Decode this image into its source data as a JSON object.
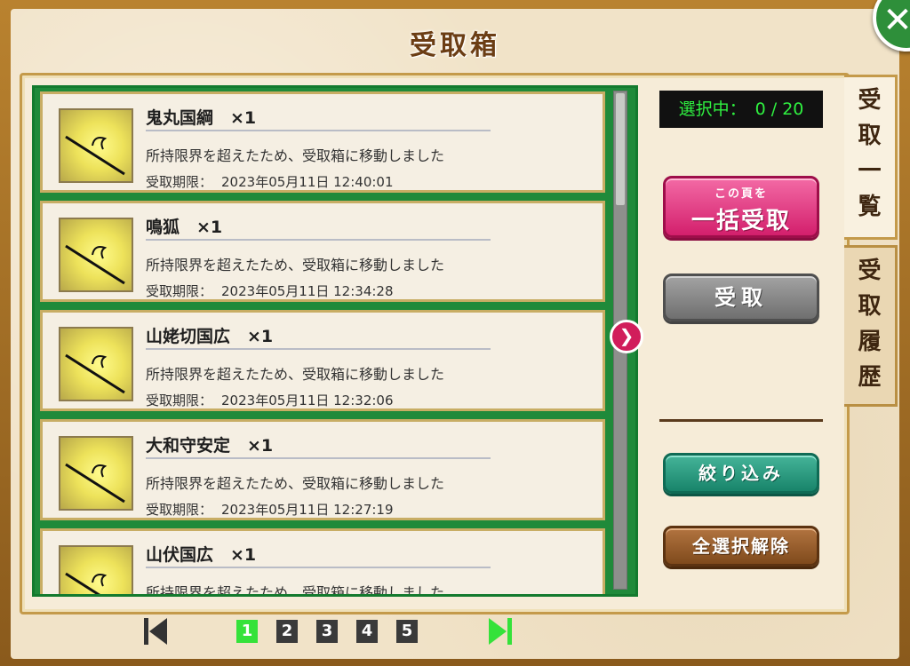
{
  "window": {
    "title": "受取箱",
    "close_label": "✕"
  },
  "selection": {
    "label": "選択中：",
    "value": "0 / 20"
  },
  "buttons": {
    "bulk_receive_sub": "この頁を",
    "bulk_receive_main": "一括受取",
    "receive": "受取",
    "filter": "絞り込み",
    "deselect_all": "全選択解除"
  },
  "tabs": [
    {
      "label": "受取一覧",
      "chars": [
        "受",
        "取",
        "一",
        "覧"
      ],
      "active": true
    },
    {
      "label": "受取履歴",
      "chars": [
        "受",
        "取",
        "履",
        "歴"
      ],
      "active": false
    }
  ],
  "list": {
    "items": [
      {
        "name": "鬼丸国綱　×1",
        "description": "所持限界を超えたため、受取箱に移動しました",
        "deadline_label": "受取期限：",
        "deadline": "2023年05月11日 12:40:01",
        "icon": "sword-icon"
      },
      {
        "name": "鳴狐　×1",
        "description": "所持限界を超えたため、受取箱に移動しました",
        "deadline_label": "受取期限：",
        "deadline": "2023年05月11日 12:34:28",
        "icon": "sword-icon"
      },
      {
        "name": "山姥切国広　×1",
        "description": "所持限界を超えたため、受取箱に移動しました",
        "deadline_label": "受取期限：",
        "deadline": "2023年05月11日 12:32:06",
        "icon": "sword-icon"
      },
      {
        "name": "大和守安定　×1",
        "description": "所持限界を超えたため、受取箱に移動しました",
        "deadline_label": "受取期限：",
        "deadline": "2023年05月11日 12:27:19",
        "icon": "sword-icon"
      },
      {
        "name": "山伏国広　×1",
        "description": "所持限界を超えたため、受取箱に移動しました",
        "deadline_label": "",
        "deadline": "",
        "icon": "sword-icon"
      }
    ]
  },
  "pager": {
    "pages": [
      "1",
      "2",
      "3",
      "4",
      "5"
    ],
    "current": "1",
    "first_icon": "skip-first-icon",
    "last_icon": "skip-last-icon"
  },
  "colors": {
    "list_border": "#1f8a3a",
    "bulk_button": "#d31f6c",
    "filter_button": "#18846a",
    "deselect_button": "#7f4a1c",
    "counter_text": "#2ff040",
    "active_page": "#35e23a"
  }
}
